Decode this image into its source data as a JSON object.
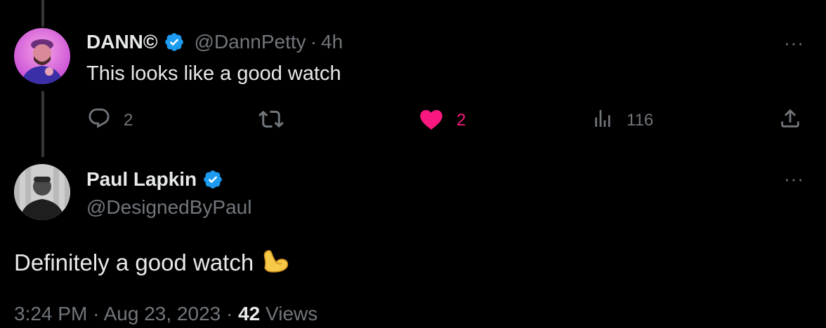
{
  "reply": {
    "name": "DANN©",
    "handle": "@DannPetty",
    "separator": "·",
    "time": "4h",
    "text": "This looks like a good watch",
    "more": "···",
    "actions": {
      "replies": "2",
      "retweets": "",
      "likes": "2",
      "views": "116"
    },
    "icons": [
      "reply-icon",
      "retweet-icon",
      "heart-icon",
      "views-icon",
      "share-icon"
    ]
  },
  "main": {
    "name": "Paul Lapkin",
    "handle": "@DesignedByPaul",
    "more": "···",
    "text": "Definitely a good watch",
    "emoji": "💪",
    "timestamp": "3:24 PM",
    "date": "Aug 23, 2023",
    "separator": "·",
    "views_count": "42",
    "views_label": "Views"
  },
  "colors": {
    "background": "#000000",
    "text": "#e7e9ea",
    "muted": "#71767b",
    "like": "#f91880",
    "verified": "#1d9bf0"
  }
}
